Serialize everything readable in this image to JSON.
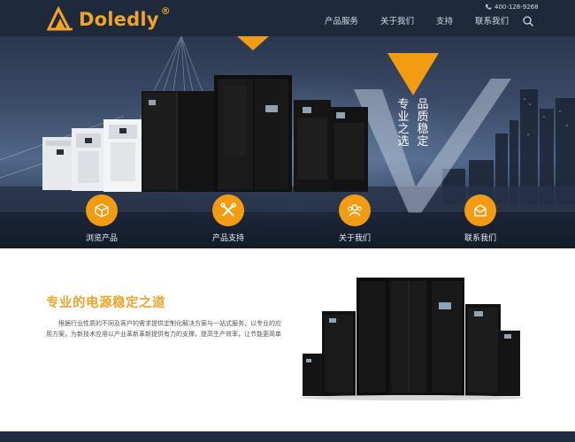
{
  "header": {
    "brand": "Doledly",
    "brand_mark": "®",
    "phone": "400-128-9268",
    "nav": [
      {
        "label": "产品服务"
      },
      {
        "label": "关于我们"
      },
      {
        "label": "支持"
      },
      {
        "label": "联系我们"
      }
    ]
  },
  "hero": {
    "slogan_col1": "专业之选",
    "slogan_col2": "品质稳定",
    "accent_color": "#f39c12",
    "quick_links": [
      {
        "label": "浏览产品",
        "icon": "box-icon"
      },
      {
        "label": "产品支持",
        "icon": "tools-icon"
      },
      {
        "label": "关于我们",
        "icon": "users-icon"
      },
      {
        "label": "联系我们",
        "icon": "envelope-icon"
      }
    ]
  },
  "intro": {
    "title": "专业的电源稳定之道",
    "text": "根据行业性质的不同及客户的需求提供定制化解决方案与一站式服务，以专业的应用方案，为新技术应用以产业革新革新提供有力的支撑，提高生产效率，让节能更简单"
  },
  "colors": {
    "header_bg": "#1e2a3b",
    "brand": "#f2a428",
    "title": "#f0a32a"
  }
}
